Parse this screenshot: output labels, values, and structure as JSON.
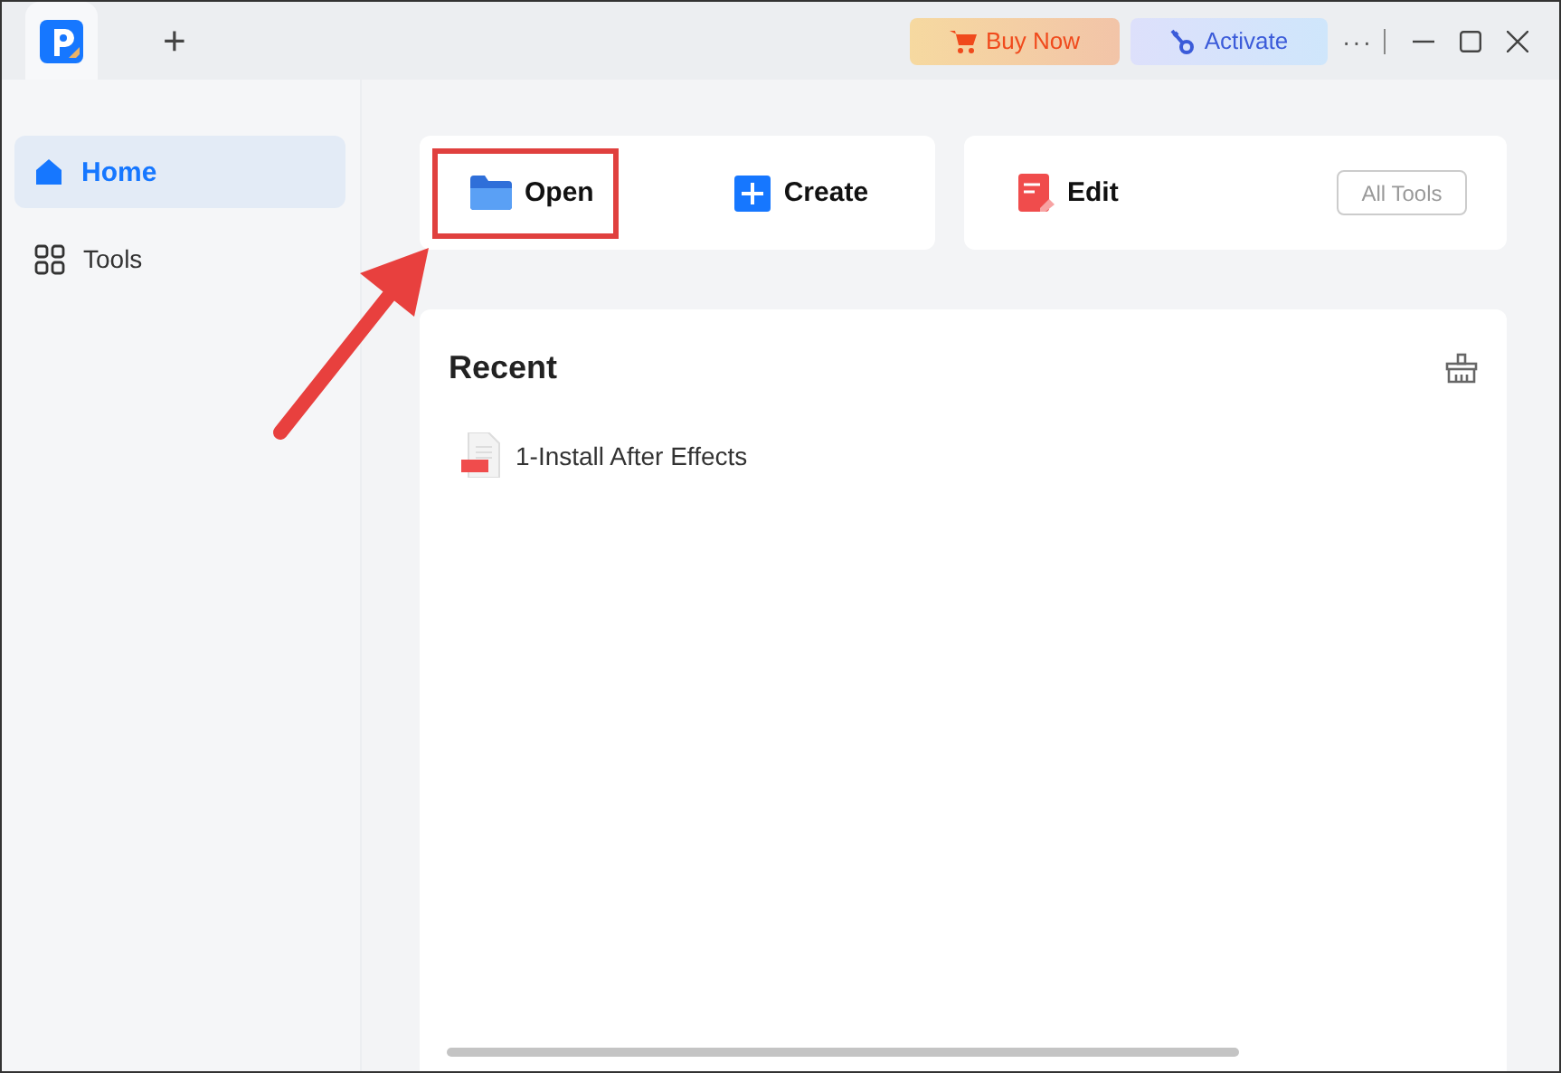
{
  "titlebar": {
    "new_tab": "+",
    "buy_button": "Buy Now",
    "activate_button": "Activate",
    "more": "···"
  },
  "sidebar": {
    "items": [
      {
        "label": "Home",
        "kind": "home",
        "selected": true
      },
      {
        "label": "Tools",
        "kind": "tools",
        "selected": false
      }
    ]
  },
  "actions": [
    {
      "label": "Open",
      "kind": "open"
    },
    {
      "label": "Create",
      "kind": "create"
    },
    {
      "label": "Edit",
      "kind": "edit"
    }
  ],
  "all_tools_button": "All Tools",
  "recent": {
    "title": "Recent",
    "files": [
      {
        "name": "1-Install After Effects"
      }
    ]
  },
  "annotations": {
    "highlight_box": true,
    "arrow": true
  }
}
